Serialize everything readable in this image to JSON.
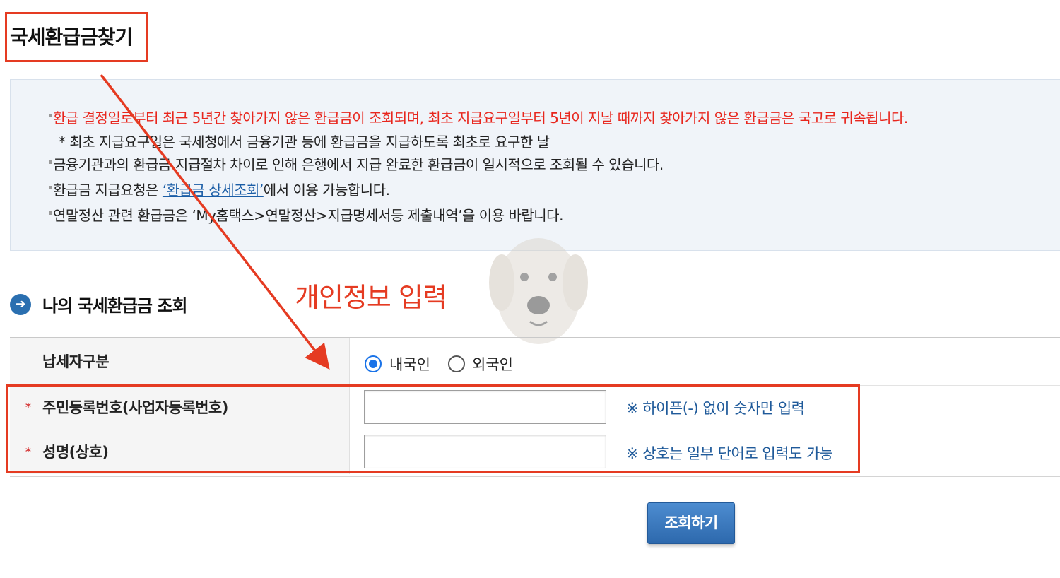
{
  "header": {
    "title": "국세환급금찾기"
  },
  "notice": {
    "line1": "환급 결정일로부터 최근 5년간 찾아가지 않은 환급금이 조회되며, 최초 지급요구일부터 5년이 지날 때까지 찾아가지 않은 환급금은 국고로 귀속됩니다.",
    "line1_note": "* 최초 지급요구일은 국세청에서 금융기관 등에 환급금을 지급하도록 최초로 요구한 날",
    "line2": "금융기관과의 환급금 지급절차 차이로 인해 은행에서 지급 완료한 환급금이 일시적으로 조회될 수 있습니다.",
    "line3_prefix": "환급금 지급요청은 ",
    "line3_link": "‘환급금 상세조회’",
    "line3_suffix": "에서 이용 가능합니다.",
    "line4": "연말정산 관련 환급금은 ‘My홈택스>연말정산>지급명세서등 제출내역’을 이용 바랍니다."
  },
  "section": {
    "title": "나의 국세환급금 조회",
    "icon": "arrow-right-circle-icon"
  },
  "annotation": {
    "text": "개인정보 입력"
  },
  "form": {
    "taxpayer_type": {
      "label": "납세자구분",
      "options": [
        "내국인",
        "외국인"
      ],
      "selected": "내국인"
    },
    "id_number": {
      "required_mark": "*",
      "label": "주민등록번호(사업자등록번호)",
      "value": "",
      "hint": "※ 하이픈(-) 없이 숫자만 입력"
    },
    "name": {
      "required_mark": "*",
      "label": "성명(상호)",
      "value": "",
      "hint": "※ 상호는 일부 단어로 입력도 가능"
    },
    "submit_label": "조회하기"
  },
  "colors": {
    "annotation_red": "#e53b22",
    "notice_red": "#e8261d",
    "link_blue": "#1a5da6",
    "button_blue": "#2d69ad",
    "notice_bg": "#f0f4f9"
  }
}
